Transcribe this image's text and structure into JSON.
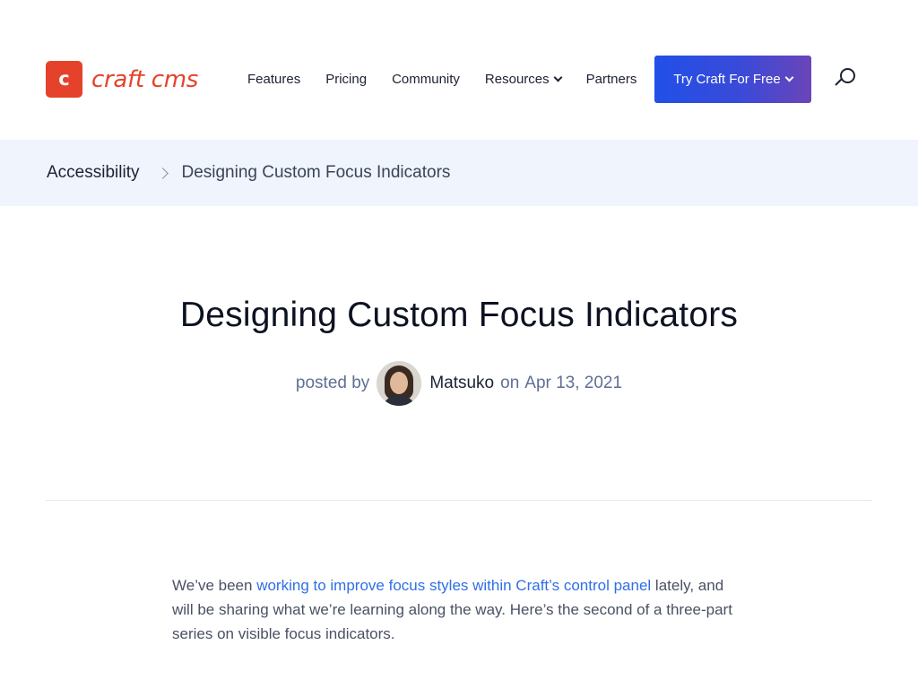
{
  "header": {
    "logo_mark": "c",
    "logo_text": "craft cms",
    "nav": {
      "features": "Features",
      "pricing": "Pricing",
      "community": "Community",
      "resources": "Resources",
      "partners": "Partners"
    },
    "cta_label": "Try Craft For Free"
  },
  "breadcrumb": {
    "parent": "Accessibility",
    "current": "Designing Custom Focus Indicators"
  },
  "article": {
    "title": "Designing Custom Focus Indicators",
    "posted_by": "posted by",
    "author": "Matsuko",
    "on": "on",
    "date": "Apr 13, 2021",
    "intro_before": "We’ve been ",
    "intro_link": "working to improve focus styles within Craft’s control panel",
    "intro_after": " lately, and will be sharing what we’re learning along the way. Here’s the second of a three-part series on visible focus indicators."
  },
  "colors": {
    "brand": "#e5422b",
    "cta_start": "#2150e8",
    "cta_end": "#6a45b8",
    "link": "#2f6fe5",
    "breadcrumb_bg": "#eff4fd"
  }
}
